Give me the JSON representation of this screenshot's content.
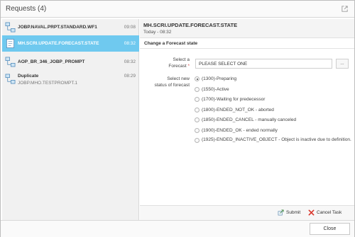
{
  "dialog": {
    "title": "Requests (4)"
  },
  "requests": [
    {
      "name": "JOBP.NAVAL.PRPT.STANDARD.WF1",
      "time": "09:08",
      "sub": ""
    },
    {
      "name": "MH.SCRI.UPDATE.FORECAST.STATE",
      "time": "08:32",
      "sub": ""
    },
    {
      "name": "AOP_BR_346_JOBP_PROMPT",
      "time": "08:32",
      "sub": ""
    },
    {
      "name": "Duplicate",
      "time": "08:29",
      "sub": "JOBP.MHO.TESTPROMPT.1"
    }
  ],
  "detail": {
    "title": "MH.SCRI.UPDATE.FORECAST.STATE",
    "date": "Today - 08:32",
    "section_title": "Change a Forecast state",
    "forecast_label_line1": "Select a",
    "forecast_label_line2": "Forecast",
    "required_marker": "*",
    "forecast_value": "PLEASE SELECT ONE",
    "browse_label": "...",
    "status_label_line1": "Select new",
    "status_label_line2": "status of forecast",
    "status_options": [
      "(1300)-Preparing",
      "(1550)-Active",
      "(1700)-Waiting for predecessor",
      "(1800)-ENDED_NOT_OK - aborted",
      "(1850)-ENDED_CANCEL - manually canceled",
      "(1900)-ENDED_OK - ended normally",
      "(1925)-ENDED_INACTIVE_OBJECT - Object is inactive due to definition."
    ],
    "selected_status_index": 0
  },
  "actions": {
    "submit_label": "Submit",
    "cancel_label": "Cancel Task"
  },
  "footer": {
    "close_label": "Close"
  },
  "colors": {
    "selected_row": "#6fc9ef",
    "cancel_icon": "#d9362c",
    "required": "#d9534f"
  }
}
